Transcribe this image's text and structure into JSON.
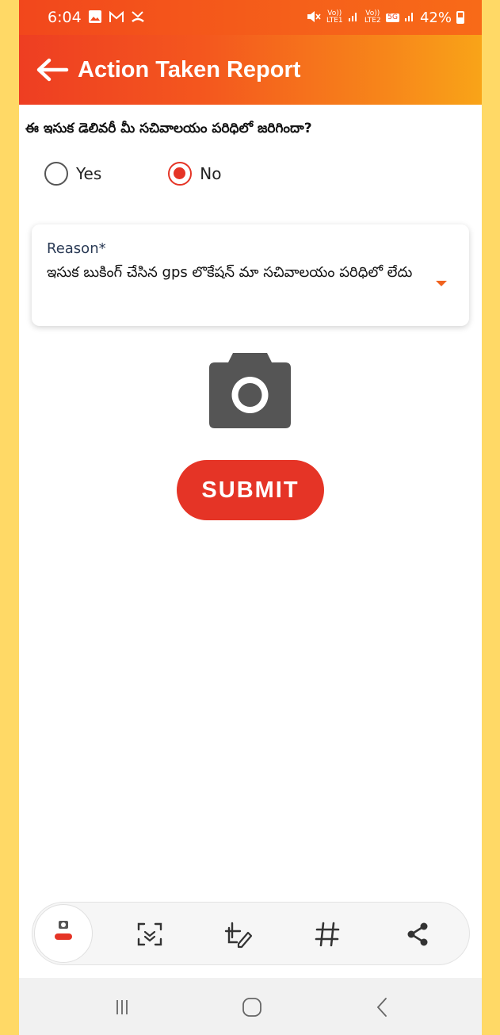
{
  "status_bar": {
    "time": "6:04",
    "battery": "42%",
    "net_1": "Vo)) LTE1",
    "net_2": "Vo)) LTE2",
    "net_5g": "5G"
  },
  "app_bar": {
    "title": "Action Taken Report"
  },
  "form": {
    "question": "ఈ ఇసుక డెలివరీ మీ సచివాలయం పరిధిలో జరిగిందా?",
    "options": [
      {
        "label": "Yes",
        "selected": false
      },
      {
        "label": "No",
        "selected": true
      }
    ],
    "reason": {
      "label": "Reason*",
      "value": "ఇసుక బుకింగ్ చేసిన gps లొకేషన్ మా సచివాలయం పరిధిలో లేదు"
    },
    "submit_label": "SUBMIT"
  },
  "colors": {
    "accent": "#E53426",
    "header_start": "#EE3E22",
    "header_end": "#F9A418",
    "frame": "#FFD966"
  },
  "toolbar": {
    "icons": [
      "screenshot-thumbnail-icon",
      "scan-text-icon",
      "edit-icon",
      "tag-icon",
      "share-icon"
    ]
  },
  "nav": {
    "icons": [
      "recents-icon",
      "home-icon",
      "back-icon"
    ]
  }
}
